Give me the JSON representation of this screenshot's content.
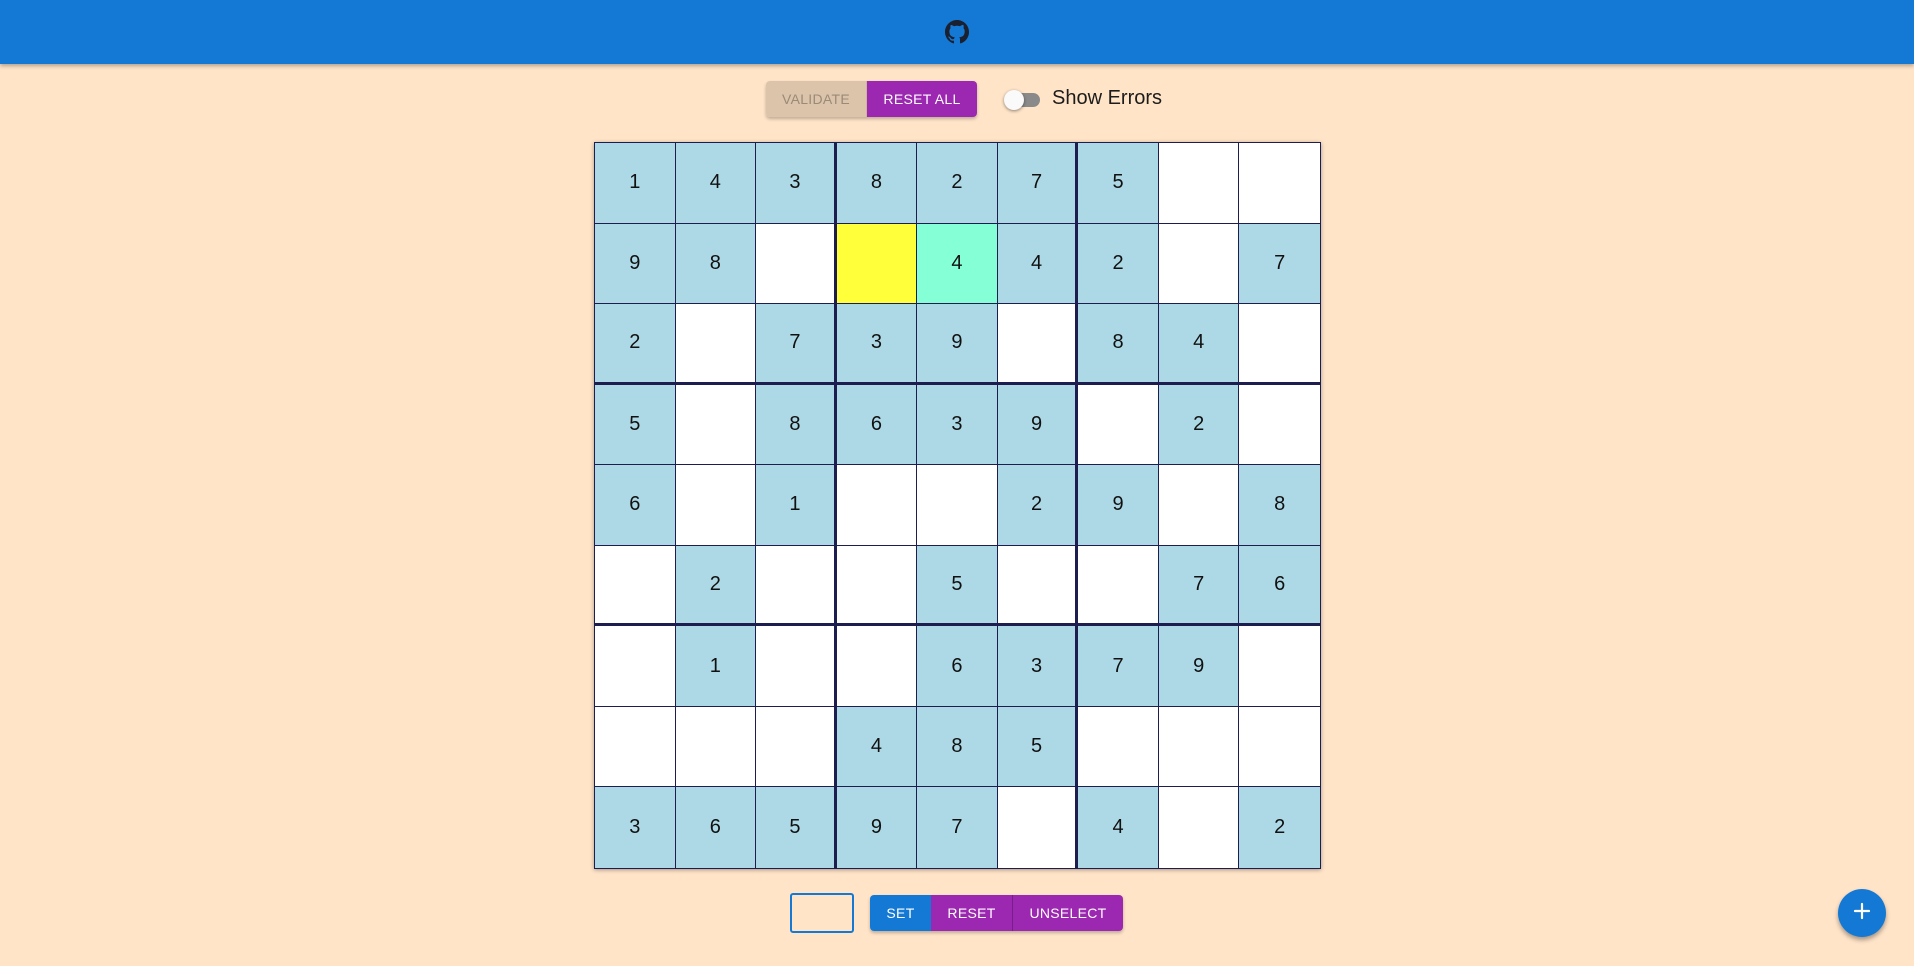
{
  "appbar": {
    "icon": "github-icon",
    "color": "#1479d4"
  },
  "toolbar": {
    "validate_label": "VALIDATE",
    "reset_all_label": "RESET ALL",
    "show_errors_label": "Show Errors",
    "show_errors_on": false
  },
  "board": {
    "selected_cell": [
      1,
      3
    ],
    "highlighted_cell": [
      1,
      4
    ],
    "rows": [
      [
        "1",
        "4",
        "3",
        "8",
        "2",
        "7",
        "5",
        "",
        ""
      ],
      [
        "9",
        "8",
        "",
        "",
        "4",
        "4",
        "2",
        "",
        "7"
      ],
      [
        "2",
        "",
        "7",
        "3",
        "9",
        "",
        "8",
        "4",
        ""
      ],
      [
        "5",
        "",
        "8",
        "6",
        "3",
        "9",
        "",
        "2",
        ""
      ],
      [
        "6",
        "",
        "1",
        "",
        "",
        "2",
        "9",
        "",
        "8"
      ],
      [
        "",
        "2",
        "",
        "",
        "5",
        "",
        "",
        "7",
        "6"
      ],
      [
        "",
        "1",
        "",
        "",
        "6",
        "3",
        "7",
        "9",
        ""
      ],
      [
        "",
        "",
        "",
        "4",
        "8",
        "5",
        "",
        "",
        ""
      ],
      [
        "3",
        "6",
        "5",
        "9",
        "7",
        "",
        "4",
        "",
        "2"
      ]
    ],
    "colors": {
      "given": "#add8e6",
      "empty": "#ffffff",
      "selected": "#ffff3a",
      "highlight": "#84ffd6"
    }
  },
  "controls": {
    "input_value": "",
    "set_label": "SET",
    "reset_label": "RESET",
    "unselect_label": "UNSELECT"
  },
  "fab": {
    "icon": "plus-icon"
  }
}
